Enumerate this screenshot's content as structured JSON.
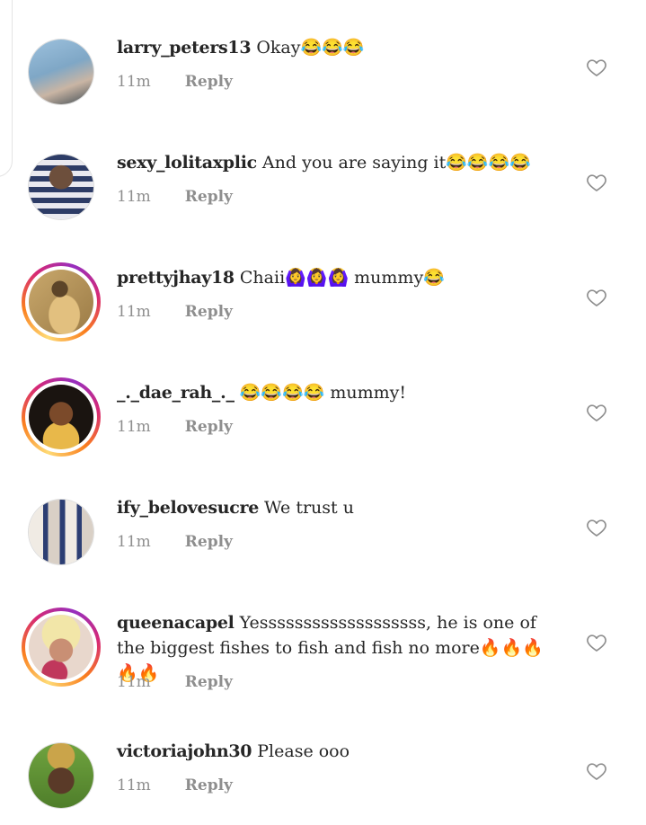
{
  "comments": [
    {
      "username": "larry_peters13",
      "text": " Okay😂😂😂",
      "time": "11m",
      "reply": "Reply",
      "avatar_colors": [
        "#8fb6d6",
        "#3b4a55",
        "#b79a86"
      ]
    },
    {
      "username": "sexy_lolitaxplic",
      "text": " And you are saying it😂😂😂😂",
      "time": "11m",
      "reply": "Reply",
      "avatar_colors": [
        "#2d3c66",
        "#e9e9ef",
        "#6d4f3c"
      ]
    },
    {
      "username": "prettyjhay18",
      "text": " Chaii🙆‍♀️🙆‍♀️🙆‍♀️ mummy😂",
      "time": "11m",
      "reply": "Reply",
      "avatar_colors": [
        "#b8975e",
        "#e2c07f",
        "#5c4428"
      ]
    },
    {
      "username": "_._dae_rah_._",
      "text": " 😂😂😂😂 mummy!",
      "time": "11m",
      "reply": "Reply",
      "avatar_colors": [
        "#1a1410",
        "#e8b84a",
        "#7b4a2a"
      ]
    },
    {
      "username": "ify_belovesucre",
      "text": " We trust u",
      "time": "11m",
      "reply": "Reply",
      "avatar_colors": [
        "#d9d0c6",
        "#2c3e73",
        "#f0ebe4"
      ]
    },
    {
      "username": "queenacapel",
      "text": " Yesssssssssssssssssss, he is one of the biggest fishes to fish and fish no more🔥🔥🔥🔥🔥",
      "time": "11m",
      "reply": "Reply",
      "avatar_colors": [
        "#e8d7cc",
        "#f2e6a8",
        "#c0385c"
      ]
    },
    {
      "username": "victoriajohn30",
      "text": " Please ooo",
      "time": "11m",
      "reply": "Reply",
      "avatar_colors": [
        "#6fa33f",
        "#caa44a",
        "#5a3a28"
      ]
    }
  ]
}
